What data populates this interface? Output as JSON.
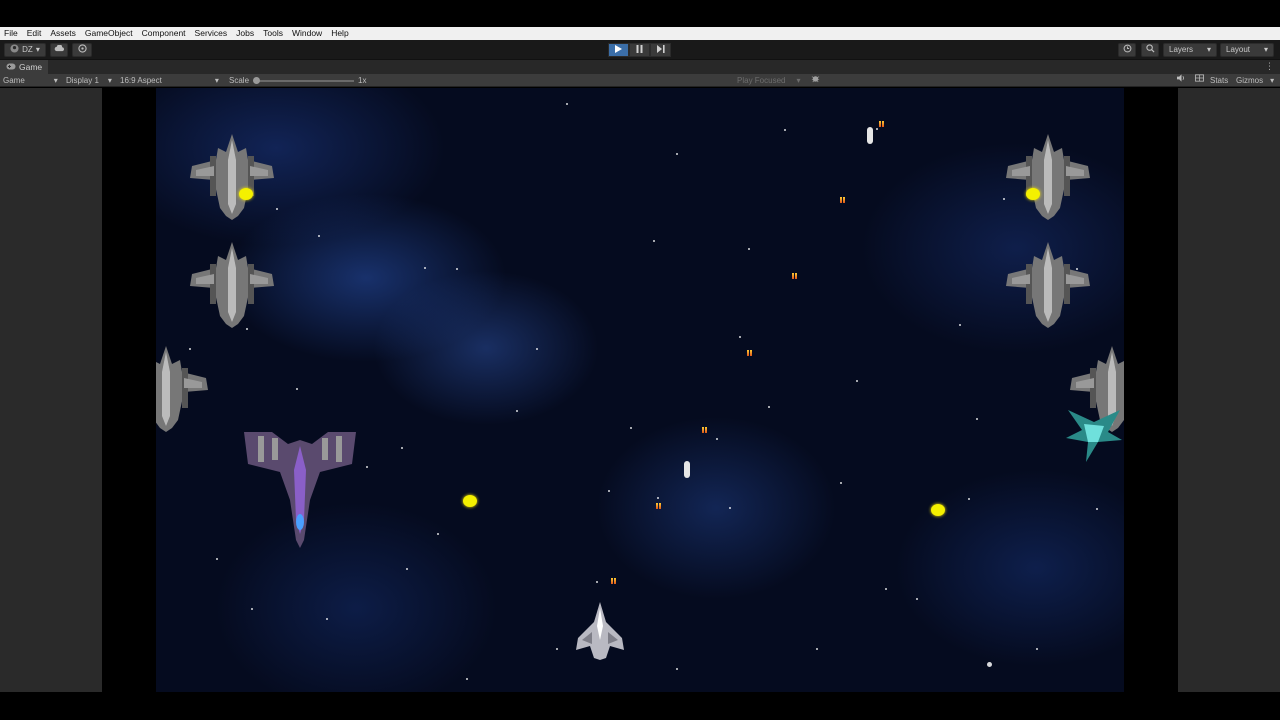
{
  "menu": {
    "file": "File",
    "edit": "Edit",
    "assets": "Assets",
    "gameobject": "GameObject",
    "component": "Component",
    "services": "Services",
    "jobs": "Jobs",
    "tools": "Tools",
    "window": "Window",
    "help": "Help"
  },
  "toolbar": {
    "account": "DZ",
    "layers": "Layers",
    "layout": "Layout"
  },
  "tab": {
    "title": "Game"
  },
  "gamebar": {
    "mode": "Game",
    "display": "Display 1",
    "aspect": "16:9 Aspect",
    "scale_label": "Scale",
    "scale_value": "1x",
    "play_focused": "Play Focused",
    "stats": "Stats",
    "gizmos": "Gizmos"
  },
  "colors": {
    "play_active": "#3b6ea8",
    "coin": "#f4f000",
    "enemy_bullet": "#e0551a",
    "player_bullet": "#e6e6e6"
  }
}
